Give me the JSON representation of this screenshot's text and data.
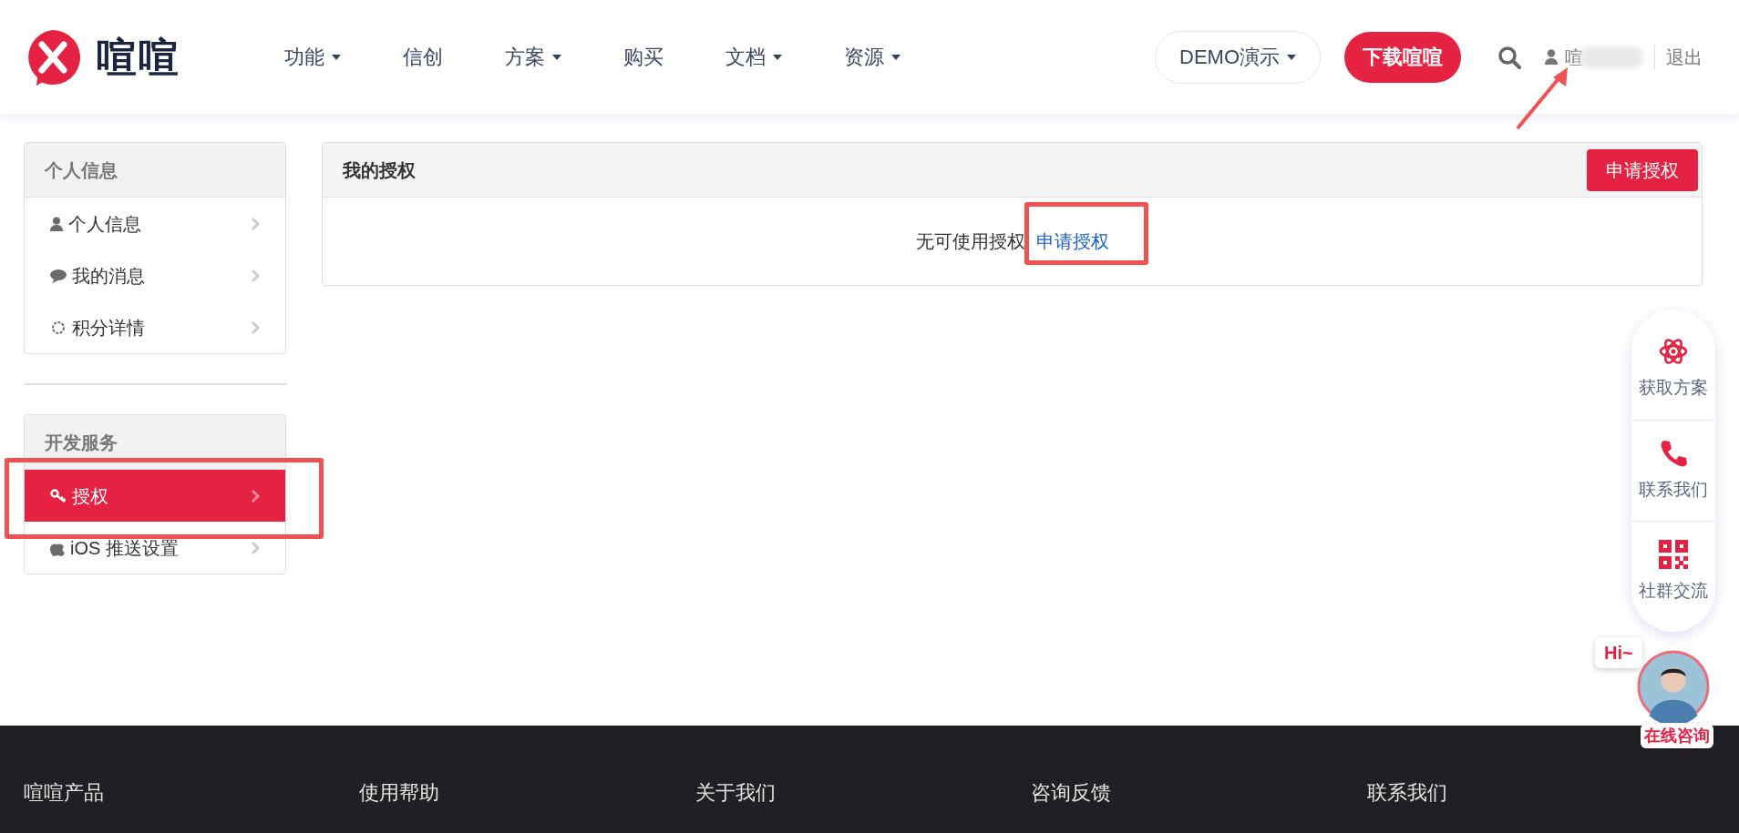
{
  "header": {
    "logo_text": "喧喧",
    "nav": [
      {
        "label": "功能",
        "dropdown": true
      },
      {
        "label": "信创",
        "dropdown": false
      },
      {
        "label": "方案",
        "dropdown": true
      },
      {
        "label": "购买",
        "dropdown": false
      },
      {
        "label": "文档",
        "dropdown": true
      },
      {
        "label": "资源",
        "dropdown": true
      }
    ],
    "demo_button": "DEMO演示",
    "download_button": "下载喧喧",
    "user_name": "喧",
    "logout": "退出"
  },
  "sidebar": {
    "sections": [
      {
        "title": "个人信息",
        "items": [
          {
            "label": "个人信息",
            "kind": "user",
            "selected": false
          },
          {
            "label": "我的消息",
            "kind": "comment",
            "selected": false
          },
          {
            "label": "积分详情",
            "kind": "gear",
            "selected": false
          }
        ]
      },
      {
        "title": "开发服务",
        "items": [
          {
            "label": "授权",
            "kind": "key",
            "selected": true
          },
          {
            "label": "iOS 推送设置",
            "kind": "apple",
            "selected": false
          }
        ]
      }
    ]
  },
  "main": {
    "title": "我的授权",
    "apply_button": "申请授权",
    "empty_text": "无可使用授权",
    "link": "申请授权"
  },
  "float_panel": {
    "items": [
      {
        "label": "获取方案",
        "kind": "atom"
      },
      {
        "label": "联系我们",
        "kind": "phone"
      },
      {
        "label": "社群交流",
        "kind": "qr"
      }
    ],
    "chat_bubble": "Hi~",
    "chat_label": "在线咨询"
  },
  "footer": {
    "columns": [
      "喧喧产品",
      "使用帮助",
      "关于我们",
      "咨询反馈",
      "联系我们"
    ]
  }
}
